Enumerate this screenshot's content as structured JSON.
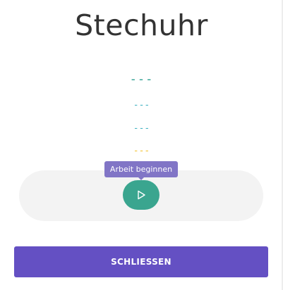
{
  "dialog": {
    "title": "Stechuhr"
  },
  "timers": {
    "primary": "---",
    "secondary": "---",
    "tertiary": "---",
    "quaternary": "---"
  },
  "controls": {
    "play_tooltip": "Arbeit beginnen",
    "play_icon": "play-icon"
  },
  "footer": {
    "close_label": "SCHLIESSEN"
  },
  "colors": {
    "accent_purple": "#6450c3",
    "tooltip_purple": "#8175c6",
    "play_green": "#3aa58f",
    "dash_teal": "#2a9d8f",
    "dash_cyan": "#42b3c2",
    "dash_yellow": "#f2c230"
  }
}
